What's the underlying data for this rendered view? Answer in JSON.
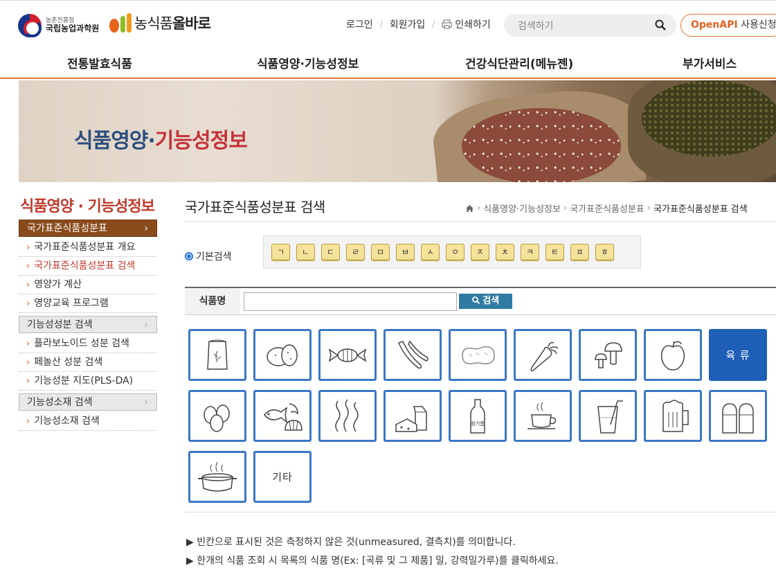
{
  "header": {
    "org_small": "농촌진흥청",
    "org_name": "국립농업과학원",
    "site_name_a": "농식품",
    "site_name_b": "올바로",
    "login": "로그인",
    "signup": "회원가입",
    "print": "인쇄하기",
    "search_placeholder": "검색하기",
    "openapi_a": "OpenAPI",
    "openapi_b": " 사용신청"
  },
  "gnb": [
    "전통발효식품",
    "식품영양·기능성정보",
    "건강식단관리(메뉴젠)",
    "부가서비스"
  ],
  "banner": {
    "title_a": "식품영양·",
    "title_b": "기능성정보"
  },
  "sidebar": {
    "title": "식품영양 · 기능성정보",
    "groups": [
      {
        "label": "국가표준식품성분표",
        "items": [
          "국가표준식품성분표 개요",
          "국가표준식품성분표 검색",
          "영양가 계산",
          "영양교육 프로그램"
        ]
      },
      {
        "label": "기능성성분 검색",
        "items": [
          "플라보노이드 성분 검색",
          "페놀산 성분 검색",
          "기능성분 지도(PLS-DA)"
        ]
      },
      {
        "label": "기능성소재 검색",
        "items": [
          "기능성소재 검색"
        ]
      }
    ]
  },
  "content": {
    "title": "국가표준식품성분표 검색",
    "breadcrumb": [
      "식품영양·기능성정보",
      "국가표준식품성분표",
      "국가표준식품성분표 검색"
    ],
    "basic_search": "기본검색",
    "consonants": [
      "ㄱ",
      "ㄴ",
      "ㄷ",
      "ㄹ",
      "ㅁ",
      "ㅂ",
      "ㅅ",
      "ㅇ",
      "ㅈ",
      "ㅊ",
      "ㅋ",
      "ㅌ",
      "ㅍ",
      "ㅎ"
    ],
    "food_name_label": "식품명",
    "search_button": "검색",
    "categories": [
      "곡류",
      "감자류",
      "당류",
      "두류",
      "견과류",
      "채소류",
      "버섯류",
      "과일류",
      "육류",
      "난류",
      "어패류",
      "해조류",
      "우유류",
      "유지류",
      "음료류",
      "주류",
      "조미료류",
      "조리가공식품류",
      "기타"
    ],
    "category_text": {
      "meat": "육 류",
      "etc": "기타"
    },
    "bottle_label": "참기름",
    "notes": [
      "▶ 빈칸으로 표시된 것은 측정하지 않은 것(unmeasured, 결측치)를 의미합니다.",
      "▶ 한개의 식품 조회 시 목록의 식품 명(Ex: [곡류 및 그 제품] 밀, 강력밀가루)를 클릭하세요."
    ]
  },
  "colors": {
    "accent": "#e4733d",
    "sidebar_active": "#8a4b1c",
    "category_border": "#3a77c8",
    "category_selected": "#1f5fb8"
  }
}
